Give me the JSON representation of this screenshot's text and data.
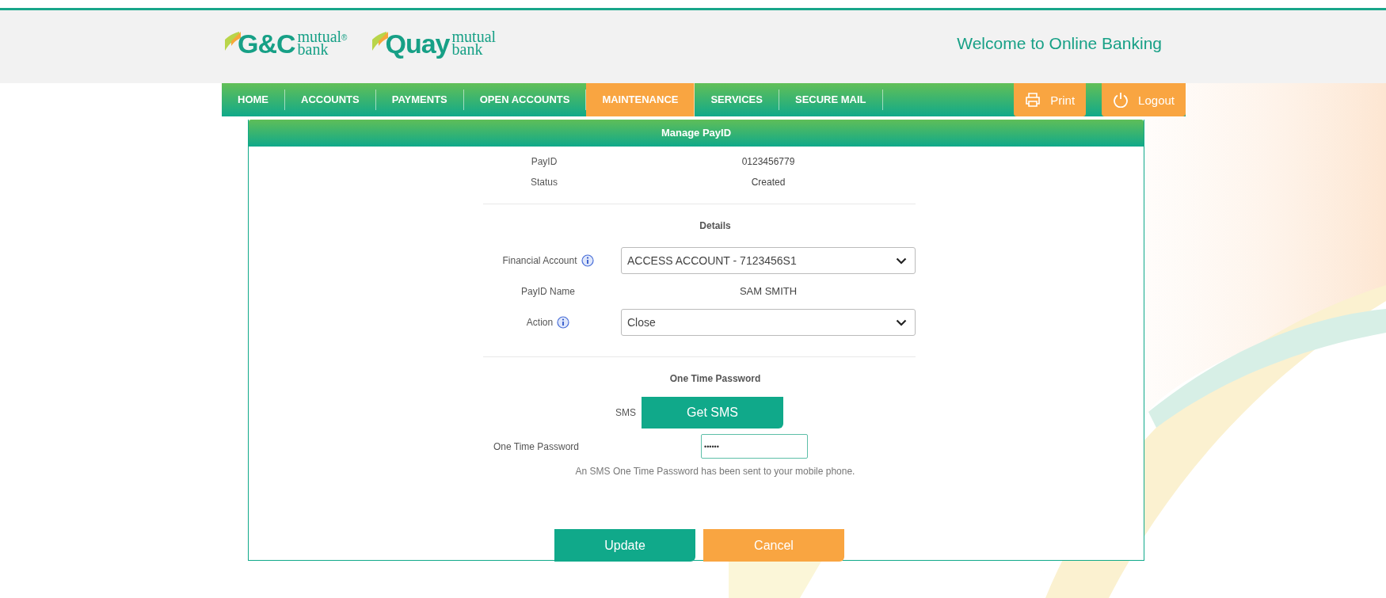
{
  "header": {
    "logos": [
      {
        "brand": "G&C",
        "line1": "mutual",
        "line2": "bank",
        "mark": "®"
      },
      {
        "brand": "Quay",
        "line1": "mutual",
        "line2": "bank"
      }
    ],
    "welcome": "Welcome to Online Banking"
  },
  "nav": {
    "items": [
      {
        "label": "HOME",
        "selected": false
      },
      {
        "label": "ACCOUNTS",
        "selected": false
      },
      {
        "label": "PAYMENTS",
        "selected": false
      },
      {
        "label": "OPEN ACCOUNTS",
        "selected": false
      },
      {
        "label": "MAINTENANCE",
        "selected": true
      },
      {
        "label": "SERVICES",
        "selected": false
      },
      {
        "label": "SECURE MAIL",
        "selected": false
      }
    ],
    "actions": [
      {
        "kind": "print",
        "label": "Print"
      },
      {
        "kind": "logout",
        "label": "Logout"
      }
    ]
  },
  "panel": {
    "title": "Manage PayID",
    "summary": [
      {
        "label": "PayID",
        "value": "0123456779"
      },
      {
        "label": "Status",
        "value": "Created"
      }
    ],
    "details_heading": "Details",
    "fields": [
      {
        "kind": "select",
        "label": "Financial Account",
        "info": true,
        "value": "ACCESS ACCOUNT - 7123456S1"
      },
      {
        "kind": "text",
        "label": "PayID Name",
        "info": false,
        "value": "SAM SMITH"
      },
      {
        "kind": "select",
        "label": "Action",
        "info": true,
        "value": "Close"
      }
    ],
    "otp": {
      "heading": "One Time Password",
      "sms_label": "SMS",
      "sms_button": "Get SMS",
      "label": "One Time Password",
      "value": "••••••",
      "message": "An SMS One Time Password has been sent to your mobile phone."
    },
    "buttons": [
      {
        "kind": "primary",
        "label": "Update"
      },
      {
        "kind": "secondary",
        "label": "Cancel"
      }
    ]
  }
}
